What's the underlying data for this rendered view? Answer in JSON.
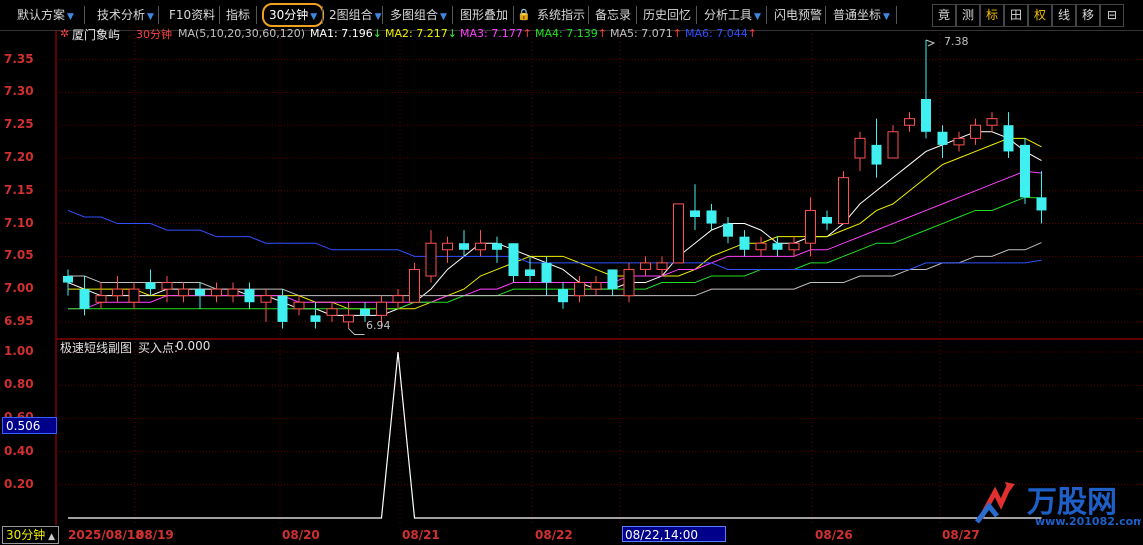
{
  "toolbar": {
    "items": [
      {
        "label": "默认方案",
        "arrow": true
      },
      {
        "label": "技术分析",
        "arrow": true
      },
      {
        "label": "F10资料",
        "arrow": false
      },
      {
        "label": "指标",
        "arrow": false
      },
      {
        "label": "30分钟",
        "arrow": true,
        "selected": true
      },
      {
        "label": "2图组合",
        "arrow": true
      },
      {
        "label": "多图组合",
        "arrow": true
      },
      {
        "label": "图形叠加",
        "arrow": false
      },
      {
        "label": "系统指示",
        "arrow": false
      },
      {
        "label": "备忘录",
        "arrow": false
      },
      {
        "label": "历史回忆",
        "arrow": false
      },
      {
        "label": "分析工具",
        "arrow": true
      },
      {
        "label": "闪电预警",
        "arrow": false
      },
      {
        "label": "普通坐标",
        "arrow": true
      }
    ],
    "right_buttons": [
      "竟",
      "测",
      "标",
      "田",
      "权",
      "线",
      "移",
      "⊟"
    ]
  },
  "main_panel": {
    "stock_name": "厦门象屿",
    "period": "30分钟",
    "ma_params": "MA(5,10,20,30,60,120)",
    "ma": [
      {
        "name": "MA1",
        "value": "7.196",
        "dir": "↓",
        "color": "#ffffff"
      },
      {
        "name": "MA2",
        "value": "7.217",
        "dir": "↓",
        "color": "#f0f000"
      },
      {
        "name": "MA3",
        "value": "7.177",
        "dir": "↑",
        "color": "#ff40ff"
      },
      {
        "name": "MA4",
        "value": "7.139",
        "dir": "↑",
        "color": "#20e020"
      },
      {
        "name": "MA5",
        "value": "7.071",
        "dir": "↑",
        "color": "#c0c0c0"
      },
      {
        "name": "MA6",
        "value": "7.044",
        "dir": "↑",
        "color": "#3050ff"
      }
    ],
    "y_ticks": [
      "7.35",
      "7.30",
      "7.25",
      "7.20",
      "7.15",
      "7.10",
      "7.05",
      "7.00",
      "6.95"
    ],
    "high_label": "7.38",
    "low_label": "6.94"
  },
  "sub_panel": {
    "title": "极速短线副图",
    "buy_label": "买入点:",
    "buy_value": "0.000",
    "y_ticks": [
      "1.00",
      "0.80",
      "0.60",
      "0.40",
      "0.20"
    ],
    "current_value": "0.506"
  },
  "x_axis": {
    "period_button": "30分钟",
    "labels": [
      "2025/08/18",
      "08/19",
      "08/20",
      "08/21",
      "08/22",
      "08/26",
      "08/27"
    ],
    "cursor_time": "08/22,14:00"
  },
  "watermark": {
    "brand": "万股网",
    "url": "www.201082.com"
  },
  "colors": {
    "up": "#ff5050",
    "down": "#40f0f0",
    "axis": "#c00000",
    "background": "#000000"
  },
  "chart_data": {
    "type": "candlestick",
    "ylim": [
      6.93,
      7.38
    ],
    "candles": [
      {
        "o": 7.02,
        "c": 7.01,
        "h": 7.03,
        "l": 6.99
      },
      {
        "o": 7.0,
        "c": 6.97,
        "h": 7.02,
        "l": 6.96
      },
      {
        "o": 6.98,
        "c": 6.99,
        "h": 7.01,
        "l": 6.97
      },
      {
        "o": 6.99,
        "c": 7.0,
        "h": 7.02,
        "l": 6.98
      },
      {
        "o": 6.98,
        "c": 7.0,
        "h": 7.01,
        "l": 6.97
      },
      {
        "o": 7.01,
        "c": 7.0,
        "h": 7.03,
        "l": 6.99
      },
      {
        "o": 7.0,
        "c": 7.01,
        "h": 7.02,
        "l": 6.98
      },
      {
        "o": 6.99,
        "c": 7.0,
        "h": 7.01,
        "l": 6.98
      },
      {
        "o": 7.0,
        "c": 6.99,
        "h": 7.01,
        "l": 6.97
      },
      {
        "o": 6.99,
        "c": 7.0,
        "h": 7.01,
        "l": 6.98
      },
      {
        "o": 6.99,
        "c": 7.0,
        "h": 7.01,
        "l": 6.98
      },
      {
        "o": 7.0,
        "c": 6.98,
        "h": 7.01,
        "l": 6.97
      },
      {
        "o": 6.98,
        "c": 6.99,
        "h": 7.0,
        "l": 6.95
      },
      {
        "o": 6.99,
        "c": 6.95,
        "h": 7.0,
        "l": 6.94
      },
      {
        "o": 6.97,
        "c": 6.98,
        "h": 6.99,
        "l": 6.96
      },
      {
        "o": 6.96,
        "c": 6.95,
        "h": 6.98,
        "l": 6.94
      },
      {
        "o": 6.96,
        "c": 6.97,
        "h": 6.98,
        "l": 6.95
      },
      {
        "o": 6.95,
        "c": 6.96,
        "h": 6.98,
        "l": 6.94
      },
      {
        "o": 6.97,
        "c": 6.96,
        "h": 6.98,
        "l": 6.95
      },
      {
        "o": 6.96,
        "c": 6.98,
        "h": 6.99,
        "l": 6.94
      },
      {
        "o": 6.98,
        "c": 6.99,
        "h": 7.0,
        "l": 6.97
      },
      {
        "o": 6.98,
        "c": 7.03,
        "h": 7.04,
        "l": 6.98
      },
      {
        "o": 7.02,
        "c": 7.07,
        "h": 7.09,
        "l": 7.01
      },
      {
        "o": 7.06,
        "c": 7.07,
        "h": 7.08,
        "l": 7.04
      },
      {
        "o": 7.07,
        "c": 7.06,
        "h": 7.09,
        "l": 7.05
      },
      {
        "o": 7.06,
        "c": 7.07,
        "h": 7.09,
        "l": 7.05
      },
      {
        "o": 7.07,
        "c": 7.06,
        "h": 7.08,
        "l": 7.04
      },
      {
        "o": 7.07,
        "c": 7.02,
        "h": 7.07,
        "l": 7.01
      },
      {
        "o": 7.03,
        "c": 7.02,
        "h": 7.05,
        "l": 7.01
      },
      {
        "o": 7.04,
        "c": 7.01,
        "h": 7.05,
        "l": 6.99
      },
      {
        "o": 7.0,
        "c": 6.98,
        "h": 7.01,
        "l": 6.97
      },
      {
        "o": 6.99,
        "c": 7.01,
        "h": 7.02,
        "l": 6.98
      },
      {
        "o": 7.0,
        "c": 7.01,
        "h": 7.02,
        "l": 6.99
      },
      {
        "o": 7.03,
        "c": 7.0,
        "h": 7.03,
        "l": 6.99
      },
      {
        "o": 6.99,
        "c": 7.03,
        "h": 7.04,
        "l": 6.98
      },
      {
        "o": 7.03,
        "c": 7.04,
        "h": 7.05,
        "l": 7.02
      },
      {
        "o": 7.03,
        "c": 7.04,
        "h": 7.05,
        "l": 7.02
      },
      {
        "o": 7.04,
        "c": 7.13,
        "h": 7.13,
        "l": 7.04
      },
      {
        "o": 7.12,
        "c": 7.11,
        "h": 7.16,
        "l": 7.09
      },
      {
        "o": 7.12,
        "c": 7.1,
        "h": 7.13,
        "l": 7.09
      },
      {
        "o": 7.1,
        "c": 7.08,
        "h": 7.11,
        "l": 7.07
      },
      {
        "o": 7.08,
        "c": 7.06,
        "h": 7.09,
        "l": 7.05
      },
      {
        "o": 7.06,
        "c": 7.07,
        "h": 7.08,
        "l": 7.05
      },
      {
        "o": 7.07,
        "c": 7.06,
        "h": 7.08,
        "l": 7.05
      },
      {
        "o": 7.06,
        "c": 7.07,
        "h": 7.08,
        "l": 7.05
      },
      {
        "o": 7.07,
        "c": 7.12,
        "h": 7.14,
        "l": 7.05
      },
      {
        "o": 7.11,
        "c": 7.1,
        "h": 7.12,
        "l": 7.09
      },
      {
        "o": 7.1,
        "c": 7.17,
        "h": 7.18,
        "l": 7.1
      },
      {
        "o": 7.2,
        "c": 7.23,
        "h": 7.24,
        "l": 7.18
      },
      {
        "o": 7.22,
        "c": 7.19,
        "h": 7.26,
        "l": 7.17
      },
      {
        "o": 7.2,
        "c": 7.24,
        "h": 7.25,
        "l": 7.2
      },
      {
        "o": 7.25,
        "c": 7.26,
        "h": 7.27,
        "l": 7.24
      },
      {
        "o": 7.29,
        "c": 7.24,
        "h": 7.38,
        "l": 7.23
      },
      {
        "o": 7.24,
        "c": 7.22,
        "h": 7.25,
        "l": 7.2
      },
      {
        "o": 7.22,
        "c": 7.23,
        "h": 7.24,
        "l": 7.21
      },
      {
        "o": 7.23,
        "c": 7.25,
        "h": 7.26,
        "l": 7.22
      },
      {
        "o": 7.25,
        "c": 7.26,
        "h": 7.27,
        "l": 7.24
      },
      {
        "o": 7.25,
        "c": 7.21,
        "h": 7.27,
        "l": 7.2
      },
      {
        "o": 7.22,
        "c": 7.14,
        "h": 7.23,
        "l": 7.13
      },
      {
        "o": 7.14,
        "c": 7.12,
        "h": 7.18,
        "l": 7.1
      }
    ],
    "ma_lines": {
      "MA1": [
        7.01,
        7.0,
        6.99,
        6.99,
        6.99,
        6.99,
        7.0,
        7.0,
        7.0,
        7.0,
        7.0,
        6.99,
        6.99,
        6.98,
        6.97,
        6.97,
        6.96,
        6.96,
        6.96,
        6.96,
        6.97,
        6.98,
        7.0,
        7.03,
        7.05,
        7.07,
        7.07,
        7.06,
        7.05,
        7.04,
        7.03,
        7.01,
        7.0,
        7.0,
        7.01,
        7.01,
        7.02,
        7.05,
        7.07,
        7.09,
        7.1,
        7.1,
        7.09,
        7.07,
        7.07,
        7.08,
        7.08,
        7.1,
        7.13,
        7.15,
        7.17,
        7.19,
        7.21,
        7.22,
        7.23,
        7.24,
        7.24,
        7.23,
        7.21,
        7.196
      ],
      "MA2": [
        7.0,
        7.0,
        7.0,
        7.0,
        7.0,
        6.99,
        6.99,
        6.99,
        6.99,
        6.99,
        6.99,
        6.99,
        6.99,
        6.99,
        6.99,
        6.98,
        6.98,
        6.97,
        6.97,
        6.97,
        6.97,
        6.97,
        6.98,
        6.99,
        7.0,
        7.02,
        7.03,
        7.04,
        7.05,
        7.05,
        7.05,
        7.04,
        7.03,
        7.02,
        7.02,
        7.02,
        7.02,
        7.02,
        7.03,
        7.05,
        7.06,
        7.07,
        7.07,
        7.08,
        7.08,
        7.08,
        7.08,
        7.09,
        7.1,
        7.12,
        7.13,
        7.15,
        7.17,
        7.19,
        7.2,
        7.21,
        7.22,
        7.23,
        7.23,
        7.217
      ],
      "MA3": [
        6.97,
        6.97,
        6.98,
        6.98,
        6.98,
        6.98,
        6.99,
        6.99,
        6.99,
        6.99,
        6.99,
        6.99,
        6.99,
        6.99,
        6.98,
        6.98,
        6.98,
        6.98,
        6.98,
        6.98,
        6.98,
        6.98,
        6.98,
        6.99,
        6.99,
        7.0,
        7.0,
        7.01,
        7.01,
        7.01,
        7.01,
        7.01,
        7.01,
        7.01,
        7.02,
        7.02,
        7.02,
        7.03,
        7.03,
        7.04,
        7.05,
        7.05,
        7.05,
        7.05,
        7.05,
        7.06,
        7.06,
        7.07,
        7.08,
        7.09,
        7.1,
        7.11,
        7.12,
        7.13,
        7.14,
        7.15,
        7.16,
        7.17,
        7.18,
        7.177
      ],
      "MA4": [
        6.97,
        6.97,
        6.97,
        6.97,
        6.97,
        6.97,
        6.97,
        6.97,
        6.97,
        6.97,
        6.97,
        6.97,
        6.97,
        6.97,
        6.97,
        6.97,
        6.97,
        6.97,
        6.97,
        6.97,
        6.97,
        6.98,
        6.98,
        6.98,
        6.99,
        6.99,
        6.99,
        7.0,
        7.0,
        7.0,
        7.0,
        7.0,
        7.0,
        7.0,
        7.0,
        7.0,
        7.01,
        7.01,
        7.01,
        7.02,
        7.02,
        7.02,
        7.03,
        7.03,
        7.03,
        7.04,
        7.04,
        7.05,
        7.06,
        7.07,
        7.07,
        7.08,
        7.09,
        7.1,
        7.11,
        7.12,
        7.12,
        7.13,
        7.14,
        7.139
      ],
      "MA5": [
        7.02,
        7.02,
        7.01,
        7.01,
        7.01,
        7.01,
        7.01,
        7.01,
        7.01,
        7.0,
        7.0,
        7.0,
        7.0,
        7.0,
        6.99,
        6.99,
        6.99,
        6.99,
        6.99,
        6.99,
        6.99,
        6.99,
        6.99,
        6.99,
        6.99,
        6.99,
        6.99,
        6.99,
        6.99,
        6.99,
        6.99,
        6.99,
        6.99,
        6.99,
        6.99,
        6.99,
        6.99,
        6.99,
        6.99,
        7.0,
        7.0,
        7.0,
        7.0,
        7.0,
        7.0,
        7.01,
        7.01,
        7.01,
        7.02,
        7.02,
        7.02,
        7.03,
        7.03,
        7.04,
        7.04,
        7.05,
        7.05,
        7.06,
        7.06,
        7.071
      ],
      "MA6": [
        7.12,
        7.11,
        7.11,
        7.1,
        7.1,
        7.1,
        7.09,
        7.09,
        7.09,
        7.08,
        7.08,
        7.08,
        7.07,
        7.07,
        7.07,
        7.07,
        7.06,
        7.06,
        7.06,
        7.06,
        7.06,
        7.05,
        7.05,
        7.05,
        7.05,
        7.05,
        7.05,
        7.05,
        7.04,
        7.04,
        7.04,
        7.04,
        7.04,
        7.04,
        7.04,
        7.04,
        7.04,
        7.04,
        7.04,
        7.04,
        7.03,
        7.03,
        7.03,
        7.03,
        7.03,
        7.03,
        7.03,
        7.03,
        7.03,
        7.03,
        7.03,
        7.03,
        7.04,
        7.04,
        7.04,
        7.04,
        7.04,
        7.04,
        7.04,
        7.044
      ]
    },
    "sub_series": {
      "name": "极速短线副图",
      "values": [
        0,
        0,
        0,
        0,
        0,
        0,
        0,
        0,
        0,
        0,
        0,
        0,
        0,
        0,
        0,
        0,
        0,
        0,
        0,
        0,
        1,
        0,
        0,
        0,
        0,
        0,
        0,
        0,
        0,
        0,
        0,
        0,
        0,
        0,
        0,
        0,
        0,
        0,
        0,
        0,
        0,
        0,
        0,
        0,
        0,
        0,
        0,
        0,
        0,
        0,
        0,
        0,
        0,
        0,
        0,
        0,
        0,
        0,
        0,
        0
      ]
    },
    "sub_ylim": [
      0,
      1.0
    ]
  }
}
